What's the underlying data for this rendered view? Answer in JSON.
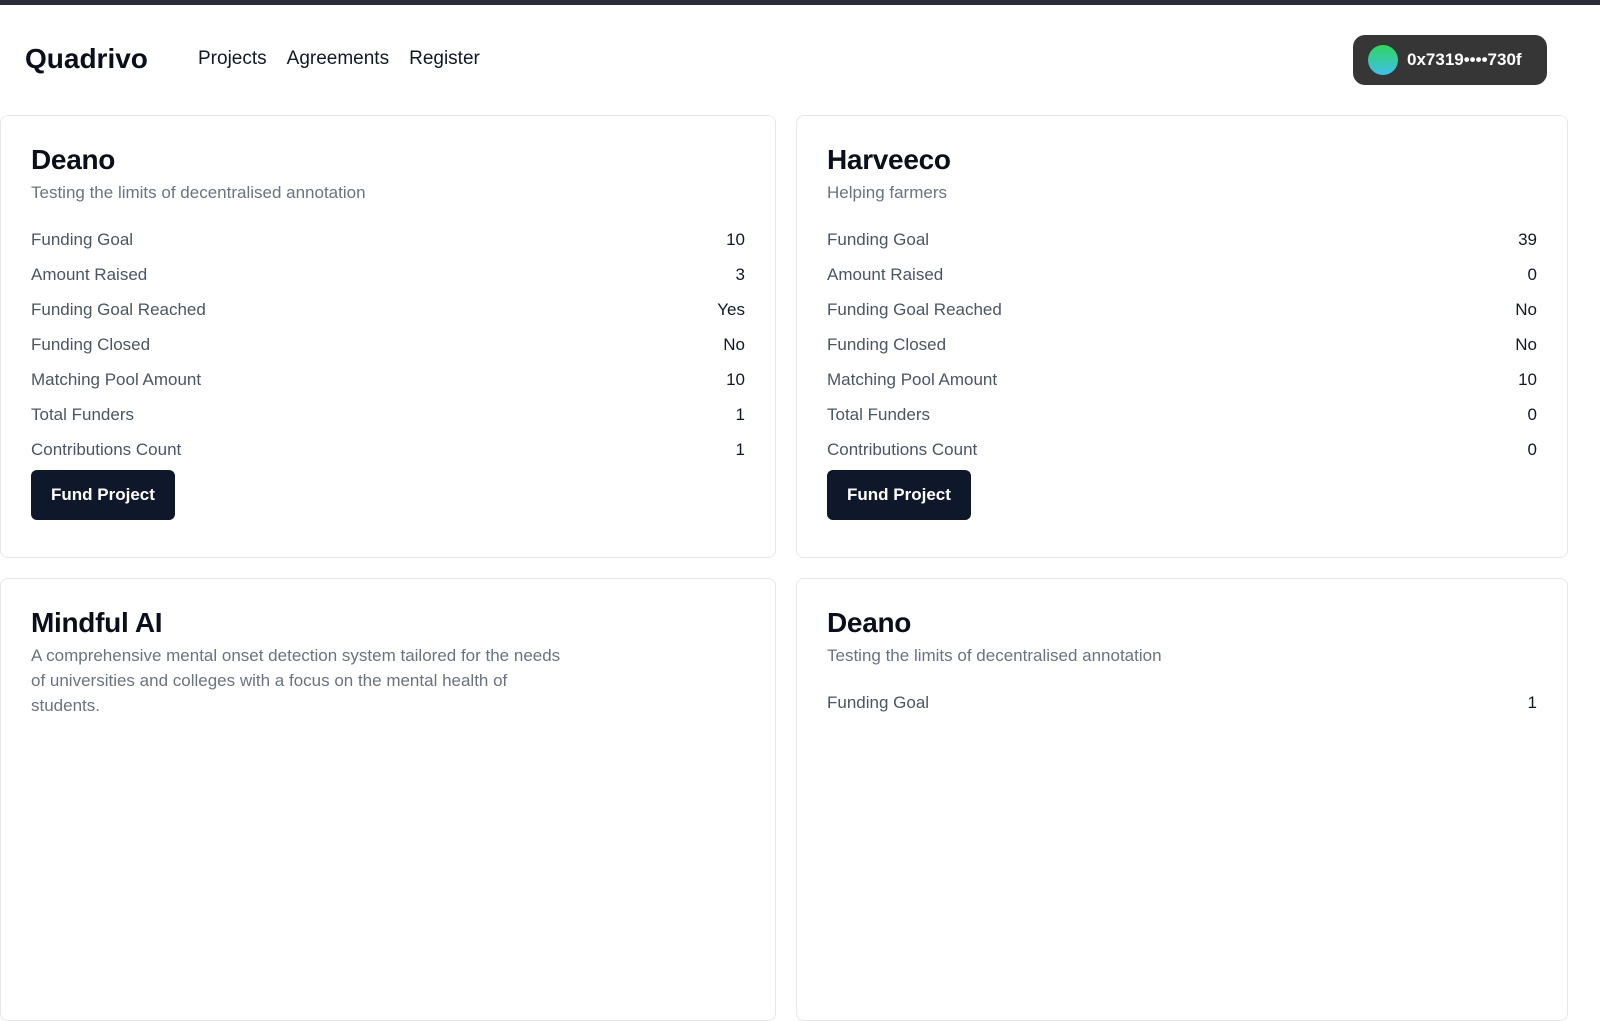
{
  "header": {
    "brand": "Quadrivo",
    "nav": [
      "Projects",
      "Agreements",
      "Register"
    ],
    "wallet": "0x7319••••730f"
  },
  "labels": [
    "Funding Goal",
    "Amount Raised",
    "Funding Goal Reached",
    "Funding Closed",
    "Matching Pool Amount",
    "Total Funders",
    "Contributions Count"
  ],
  "fund_label": "Fund Project",
  "projects": [
    {
      "name": "Deano",
      "desc": "Testing the limits of decentralised annotation",
      "values": [
        "10",
        "3",
        "Yes",
        "No",
        "10",
        "1",
        "1"
      ]
    },
    {
      "name": "Harveeco",
      "desc": "Helping farmers",
      "values": [
        "39",
        "0",
        "No",
        "No",
        "10",
        "0",
        "0"
      ]
    },
    {
      "name": "Mindful AI",
      "desc": "A comprehensive mental onset detection system tailored for the needs of universities and colleges with a focus on the mental health of students.",
      "values": []
    },
    {
      "name": "Deano",
      "desc": "Testing the limits of decentralised annotation",
      "values": [
        "1"
      ]
    }
  ]
}
